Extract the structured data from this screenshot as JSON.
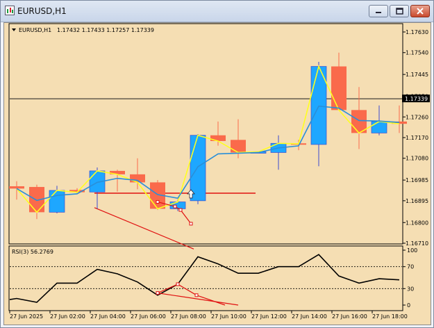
{
  "window": {
    "title": "EURUSD,H1",
    "header_symbol": "EURUSD,H1",
    "header_ohlc": "1.17432 1.17433 1.17257 1.17339",
    "indicator_label": "RSI(3) 56.2769"
  },
  "colors": {
    "background": "#f5deb3",
    "bull_body": "#1ea7ff",
    "bear_body": "#fa6a4b",
    "wick_bull": "#3a4ad0",
    "wick_bear": "#fa6a4b",
    "yellow_line": "#ffff1e",
    "blue_line": "#2a8fd8",
    "red_line": "#e01010",
    "rsi_line": "#000000",
    "price_line": "#1a1a1a"
  },
  "price_axis": {
    "labels": [
      "1.17630",
      "1.17540",
      "1.17445",
      "1.17350",
      "1.17260",
      "1.17170",
      "1.17080",
      "1.16985",
      "1.16895",
      "1.16800",
      "1.16710"
    ],
    "current_price": "1.17339"
  },
  "rsi_axis": {
    "labels": [
      "100",
      "70",
      "30",
      "0"
    ],
    "levels": [
      70,
      30
    ]
  },
  "time_axis": {
    "labels": [
      "27 Jun 2025",
      "27 Jun 02:00",
      "27 Jun 04:00",
      "27 Jun 06:00",
      "27 Jun 08:00",
      "27 Jun 10:00",
      "27 Jun 12:00",
      "27 Jun 14:00",
      "27 Jun 16:00",
      "27 Jun 18:00"
    ]
  },
  "candles": [
    {
      "o": 1.16958,
      "h": 1.1698,
      "l": 1.169,
      "c": 1.16948
    },
    {
      "o": 1.16955,
      "h": 1.16965,
      "l": 1.16815,
      "c": 1.16845
    },
    {
      "o": 1.16845,
      "h": 1.1696,
      "l": 1.1684,
      "c": 1.1694
    },
    {
      "o": 1.16942,
      "h": 1.1695,
      "l": 1.16925,
      "c": 1.16932
    },
    {
      "o": 1.16933,
      "h": 1.1704,
      "l": 1.1686,
      "c": 1.17025
    },
    {
      "o": 1.17025,
      "h": 1.1703,
      "l": 1.16935,
      "c": 1.1701
    },
    {
      "o": 1.1701,
      "h": 1.1708,
      "l": 1.16945,
      "c": 1.16975
    },
    {
      "o": 1.16975,
      "h": 1.16985,
      "l": 1.16855,
      "c": 1.1686
    },
    {
      "o": 1.1686,
      "h": 1.169,
      "l": 1.1685,
      "c": 1.1689
    },
    {
      "o": 1.16895,
      "h": 1.17185,
      "l": 1.1688,
      "c": 1.1718
    },
    {
      "o": 1.1718,
      "h": 1.1724,
      "l": 1.17135,
      "c": 1.17155
    },
    {
      "o": 1.1716,
      "h": 1.1725,
      "l": 1.1708,
      "c": 1.17105
    },
    {
      "o": 1.17105,
      "h": 1.1711,
      "l": 1.17105,
      "c": 1.17108
    },
    {
      "o": 1.17105,
      "h": 1.1718,
      "l": 1.1703,
      "c": 1.17145
    },
    {
      "o": 1.17145,
      "h": 1.1716,
      "l": 1.17115,
      "c": 1.17143
    },
    {
      "o": 1.1714,
      "h": 1.175,
      "l": 1.17045,
      "c": 1.1748
    },
    {
      "o": 1.1748,
      "h": 1.1754,
      "l": 1.173,
      "c": 1.1729
    },
    {
      "o": 1.1729,
      "h": 1.1739,
      "l": 1.1712,
      "c": 1.1719
    },
    {
      "o": 1.1719,
      "h": 1.1731,
      "l": 1.1718,
      "c": 1.1724
    },
    {
      "o": 1.1724,
      "h": 1.1731,
      "l": 1.1719,
      "c": 1.1723
    }
  ],
  "rsi_values": [
    12,
    5,
    40,
    40,
    65,
    57,
    42,
    18,
    38,
    88,
    75,
    58,
    58,
    70,
    70,
    92,
    53,
    40,
    48,
    46
  ],
  "support_line": {
    "price": 1.16928
  },
  "red_trend_price": [
    1.16865,
    1.16685
  ],
  "divergence_points_price": [
    1.1689,
    1.1687,
    1.16855,
    1.16795
  ],
  "divergence_points_rsi": [
    22,
    38,
    18,
    0
  ]
}
